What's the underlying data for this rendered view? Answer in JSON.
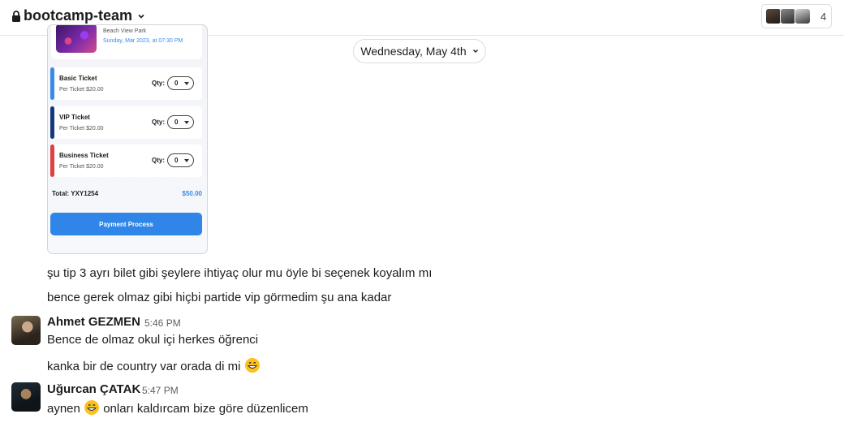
{
  "header": {
    "channel_name": "bootcamp-team",
    "member_count": "4"
  },
  "date_divider": "Wednesday, May 4th",
  "attachment": {
    "event_venue": "Beach View Park",
    "event_date": "Sunday, Mar 2023, at 07:30 PM",
    "tickets": [
      {
        "name": "Basic Ticket",
        "price": "Per Ticket $20.00",
        "qty_label": "Qty:",
        "qty": "0",
        "color": "#3a8be8"
      },
      {
        "name": "VIP Ticket",
        "price": "Per Ticket $20.00",
        "qty_label": "Qty:",
        "qty": "0",
        "color": "#17397a"
      },
      {
        "name": "Business Ticket",
        "price": "Per Ticket $20.00",
        "qty_label": "Qty:",
        "qty": "0",
        "color": "#e0403f"
      }
    ],
    "total_label": "Total: YXY1254",
    "total_value": "$50.00",
    "button": "Payment Process"
  },
  "messages": [
    {
      "text": "şu tip 3 ayrı bilet gibi şeylere ihtiyaç olur mu öyle bi seçenek koyalım mı"
    },
    {
      "text": "bence gerek olmaz gibi hiçbi partide vip görmedim şu ana kadar"
    },
    {
      "sender": "Ahmet GEZMEN",
      "time": "5:46 PM",
      "text": "Bence de olmaz okul içi herkes öğrenci"
    },
    {
      "text": "kanka bir de country var orada di mi",
      "emoji": "grinning-face-emoji"
    },
    {
      "sender": "Uğurcan ÇATAK",
      "time": "5:47 PM",
      "text_before": "aynen",
      "emoji": "grinning-face-emoji",
      "text_after": "onları kaldırcam bize göre düzenlicem"
    }
  ],
  "icons": {
    "lock": "lock-icon",
    "chevron": "chevron-down-icon"
  }
}
